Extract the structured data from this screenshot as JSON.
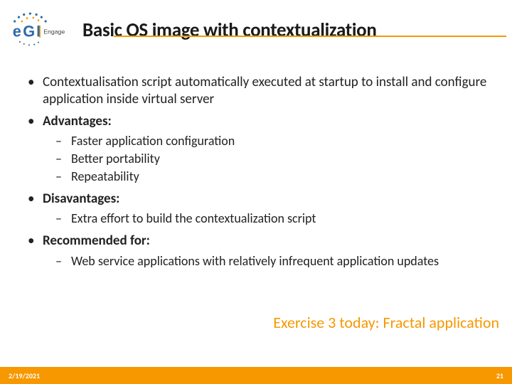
{
  "header": {
    "logo_name": "EGI-Engage",
    "title": "Basic OS image with contextualization"
  },
  "bullets": {
    "b1": "Contextualisation script automatically executed at startup to install and configure application inside virtual server",
    "b2_label": "Advantages:",
    "b2_items": {
      "i1": "Faster application configuration",
      "i2": "Better portability",
      "i3": "Repeatability"
    },
    "b3_label": "Disavantages:",
    "b3_items": {
      "i1": "Extra effort to build the contextualization script"
    },
    "b4_label": "Recommended for:",
    "b4_items": {
      "i1": "Web service applications with relatively infrequent application updates"
    }
  },
  "exercise_note": "Exercise 3 today: Fractal application",
  "footer": {
    "date": "2/19/2021",
    "page": "21"
  },
  "colors": {
    "accent": "#f79800",
    "logo_blue": "#2f6aa6"
  }
}
